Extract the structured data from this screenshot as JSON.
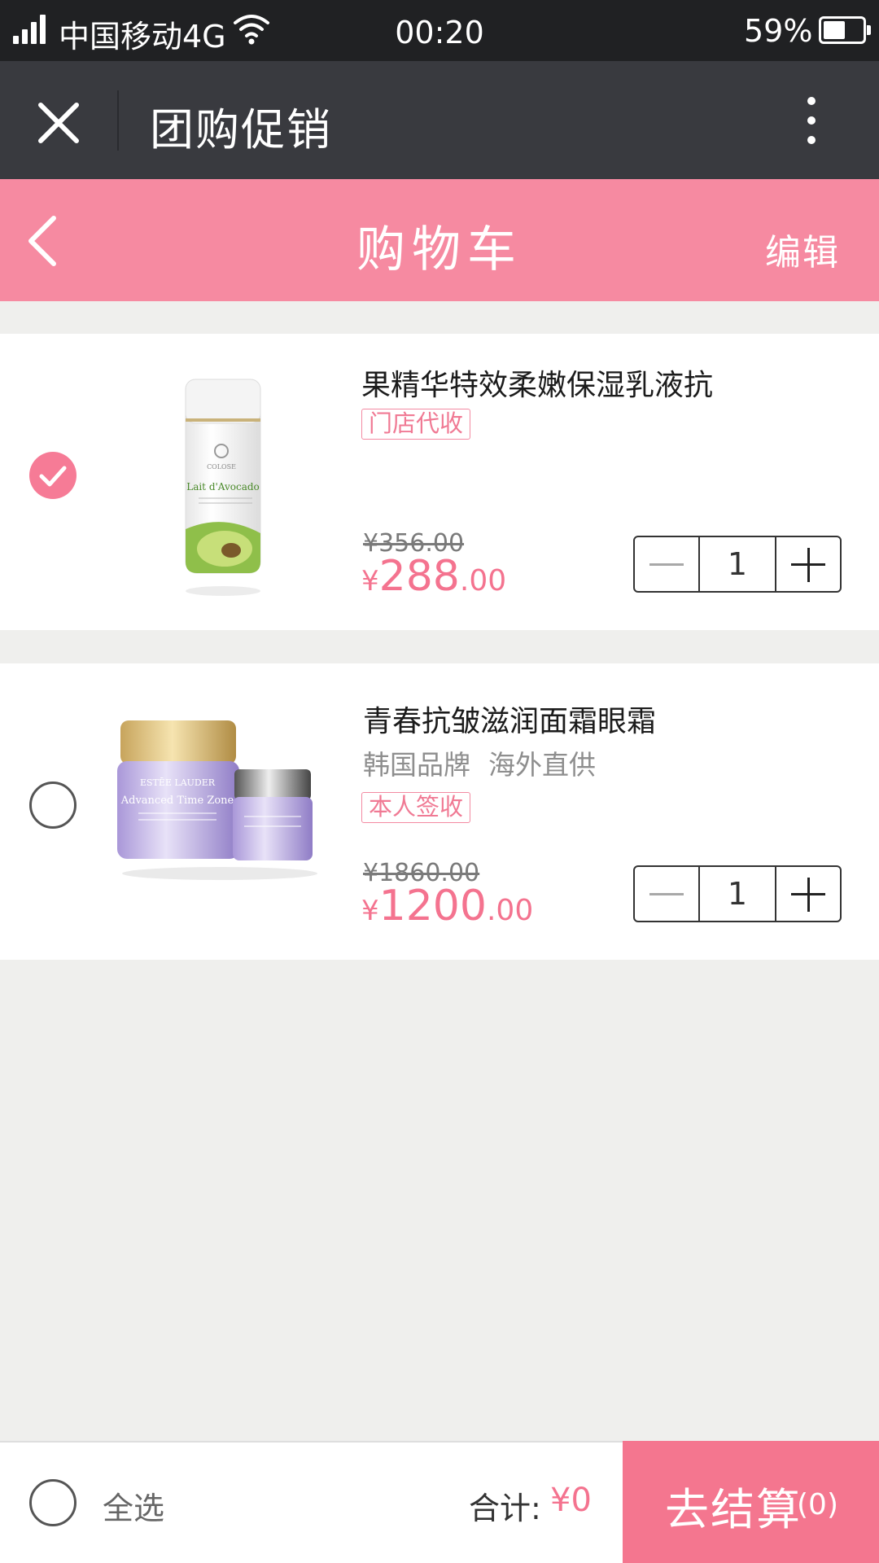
{
  "status_bar": {
    "carrier": "中国移动4G",
    "time": "00:20",
    "battery": "59%",
    "battery_level": 0.59,
    "icons": [
      "signal-icon",
      "wifi-icon",
      "battery-icon"
    ]
  },
  "title_bar": {
    "title": "团购促销",
    "icons": [
      "close-icon",
      "more-icon"
    ]
  },
  "cart_header": {
    "title": "购物车",
    "edit_label": "编辑",
    "icons": [
      "back-chevron-icon"
    ]
  },
  "items": [
    {
      "checked": true,
      "name": "果精华特效柔嫩保湿乳液抗",
      "tag": "门店代收",
      "original_price": "¥356.00",
      "price_currency": "¥",
      "price_integer": "288",
      "price_decimal": ".00",
      "quantity": "1",
      "image_label": "Lait d'Avocado",
      "image_brand": "COLOSE"
    },
    {
      "checked": false,
      "name": "青春抗皱滋润面霜眼霜",
      "subtitles": [
        "韩国品牌",
        "海外直供"
      ],
      "tag": "本人签收",
      "original_price": "¥1860.00",
      "price_currency": "¥",
      "price_integer": "1200",
      "price_decimal": ".00",
      "quantity": "1",
      "image_label": "Advanced Time Zone",
      "image_brand": "ESTĒE LAUDER"
    }
  ],
  "bottom_bar": {
    "select_all_label": "全选",
    "total_label": "合计:",
    "total_value": "¥0",
    "checkout_label": "去结算",
    "checkout_count": "(0)"
  },
  "colors": {
    "accent_pink": "#f68aa1",
    "price_pink": "#f4738f",
    "title_bar_bg": "#393a3f",
    "status_bar_bg": "#202123"
  }
}
